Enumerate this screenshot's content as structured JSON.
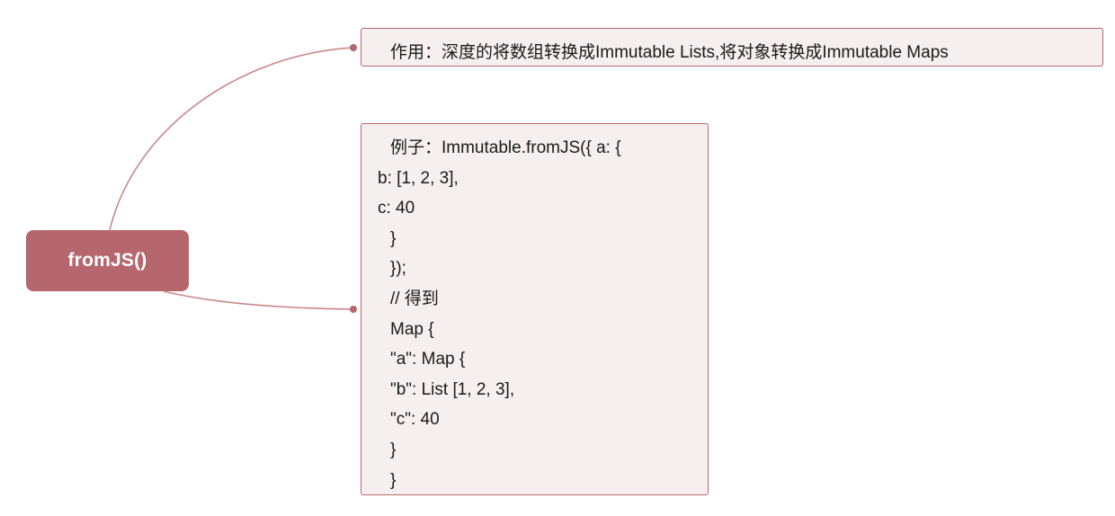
{
  "colors": {
    "root_fill": "#b6676e",
    "connector": "#c9878b",
    "box_border": "#b86870",
    "box_fill": "#f6efef"
  },
  "root": {
    "label": "fromJS()"
  },
  "purpose": {
    "text": "作用：深度的将数组转换成Immutable Lists,将对象转换成Immutable Maps"
  },
  "example": {
    "lines": [
      "例子：Immutable.fromJS({ a: {",
      "b: [1, 2, 3],",
      "c: 40",
      "}",
      "});",
      "// 得到",
      "Map {",
      "\"a\": Map {",
      "\"b\": List [1, 2, 3],",
      "\"c\": 40",
      "}",
      "}"
    ]
  }
}
